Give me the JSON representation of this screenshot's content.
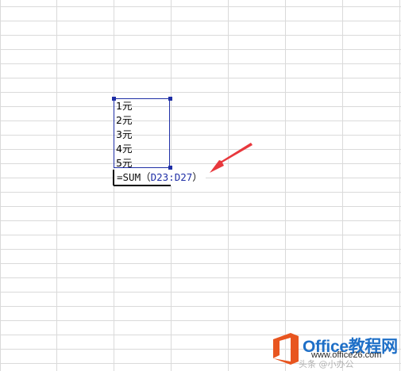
{
  "sheet": {
    "cells": {
      "d23": "1元",
      "d24": "2元",
      "d25": "3元",
      "d26": "4元",
      "d27": "5元"
    },
    "formula_cell": {
      "prefix": "=SUM（",
      "range": "D23:D27",
      "suffix": "）"
    }
  },
  "annotation": {
    "arrow_color": "#e8383d",
    "arrow_icon": "red-pointer-arrow-icon"
  },
  "watermark": {
    "logo_icon": "office-logo-icon",
    "logo_color": "#e8551f",
    "title": "Office教程网",
    "site": "www.office26.com",
    "credit": "头条 @小办公"
  },
  "colors": {
    "grid": "#dadada",
    "selection": "#1f2fa6",
    "link_blue": "#1e6fc7"
  }
}
